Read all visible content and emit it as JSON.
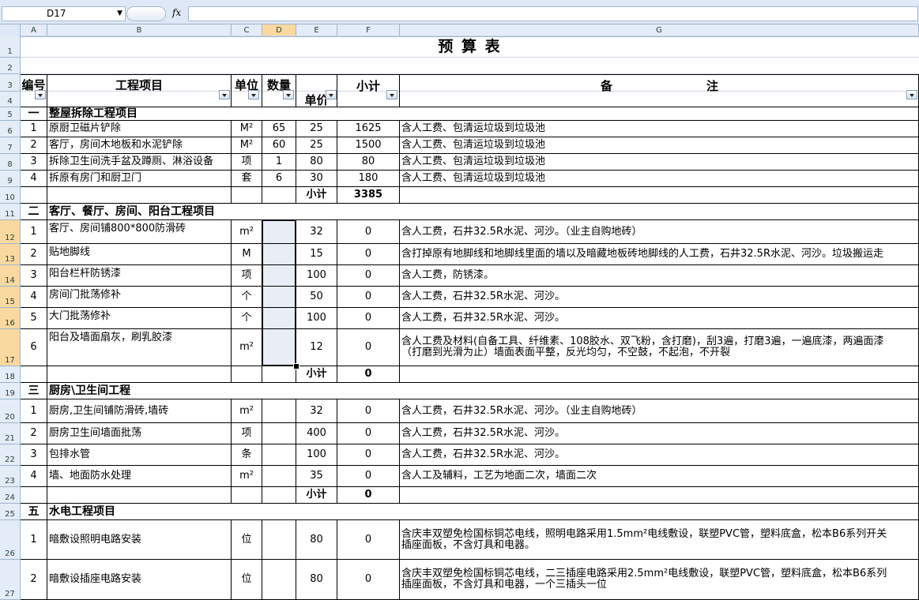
{
  "name_box": "D17",
  "fx_label": "fx",
  "formula_value": "",
  "columns": [
    "A",
    "B",
    "C",
    "D",
    "E",
    "F",
    "G"
  ],
  "rows": [
    "1",
    "2",
    "3",
    "4",
    "5",
    "6",
    "7",
    "8",
    "9",
    "10",
    "11",
    "12",
    "13",
    "14",
    "15",
    "16",
    "17",
    "18",
    "19",
    "20",
    "21",
    "22",
    "23",
    "24",
    "25",
    "26",
    "27"
  ],
  "title": "预 算 表",
  "header": {
    "no": "编号",
    "item": "工程项目",
    "unit": "单位",
    "qty": "数量",
    "price": "单价",
    "subtotal": "小计",
    "note_a": "备",
    "note_b": "注"
  },
  "sections": [
    {
      "no": "一",
      "title": "整屋拆除工程项目"
    },
    {
      "no": "二",
      "title": "客厅、餐厅、房间、阳台工程项目"
    },
    {
      "no": "三",
      "title": "厨房\\卫生间工程"
    },
    {
      "no": "五",
      "title": "水电工程项目"
    }
  ],
  "items1": [
    {
      "no": "1",
      "name": "原厨卫磁片铲除",
      "unit": "M²",
      "qty": "65",
      "price": "25",
      "sub": "1625",
      "note": "含人工费、包清运垃圾到垃圾池"
    },
    {
      "no": "2",
      "name": "客厅，房间木地板和水泥铲除",
      "unit": "M²",
      "qty": "60",
      "price": "25",
      "sub": "1500",
      "note": "含人工费、包清运垃圾到垃圾池"
    },
    {
      "no": "3",
      "name": "拆除卫生间洗手盆及蹲厕、淋浴设备",
      "unit": "项",
      "qty": "1",
      "price": "80",
      "sub": "80",
      "note": "含人工费、包清运垃圾到垃圾池"
    },
    {
      "no": "4",
      "name": "拆原有房门和厨卫门",
      "unit": "套",
      "qty": "6",
      "price": "30",
      "sub": "180",
      "note": "含人工费、包清运垃圾到垃圾池"
    }
  ],
  "items2": [
    {
      "no": "1",
      "name": "客厅、房间铺800*800防滑砖",
      "unit": "m²",
      "qty": "",
      "price": "32",
      "sub": "0",
      "note": "含人工费，石井32.5R水泥、河沙。（业主自购地砖）"
    },
    {
      "no": "2",
      "name": "贴地脚线",
      "unit": "M",
      "qty": "",
      "price": "15",
      "sub": "0",
      "note": "含打掉原有地脚线和地脚线里面的墙以及暗藏地板砖地脚线的人工费，石井32.5R水泥、河沙。垃圾搬运走"
    },
    {
      "no": "3",
      "name": "阳台栏杆防锈漆",
      "unit": "项",
      "qty": "",
      "price": "100",
      "sub": "0",
      "note": "含人工费，防锈漆。"
    },
    {
      "no": "4",
      "name": "房间门批荡修补",
      "unit": "个",
      "qty": "",
      "price": "50",
      "sub": "0",
      "note": "含人工费，石井32.5R水泥、河沙。"
    },
    {
      "no": "5",
      "name": "大门批荡修补",
      "unit": "个",
      "qty": "",
      "price": "100",
      "sub": "0",
      "note": "含人工费，石井32.5R水泥、河沙。"
    },
    {
      "no": "6",
      "name": "阳台及墙面扇灰，刷乳胶漆",
      "unit": "m²",
      "qty": "",
      "price": "12",
      "sub": "0",
      "note": "含人工费及材料(自备工具、纤维素、108胶水、双飞粉，含打磨)，刮3遍，打磨3遍，一遍底漆，两遍面漆",
      "note2": "（打磨到光滑为止）墙面表面平整，反光均匀，不空鼓，不起泡，不开裂"
    }
  ],
  "items3": [
    {
      "no": "1",
      "name": "厨房,卫生间铺防滑砖,墙砖",
      "unit": "m²",
      "qty": "",
      "price": "32",
      "sub": "0",
      "note": "含人工费，石井32.5R水泥、河沙。（业主自购地砖）"
    },
    {
      "no": "2",
      "name": "厨房卫生间墙面批荡",
      "unit": "项",
      "qty": "",
      "price": "400",
      "sub": "0",
      "note": "含人工费，石井32.5R水泥、河沙。"
    },
    {
      "no": "3",
      "name": "包排水管",
      "unit": "条",
      "qty": "",
      "price": "100",
      "sub": "0",
      "note": "含人工费，石井32.5R水泥、河沙。"
    },
    {
      "no": "4",
      "name": "墙、地面防水处理",
      "unit": "m²",
      "qty": "",
      "price": "35",
      "sub": "0",
      "note": "含人工及辅料，工艺为地面二次，墙面二次"
    }
  ],
  "items5": [
    {
      "no": "1",
      "name": "暗敷设照明电路安装",
      "unit": "位",
      "qty": "",
      "price": "80",
      "sub": "0",
      "note": "含庆丰双塑免检国标铜芯电线，照明电路采用1.5mm²电线敷设，联塑PVC管，塑料底盒，松本B6系列开关",
      "note2": "插座面板，不含灯具和电器。"
    },
    {
      "no": "2",
      "name": "暗敷设插座电路安装",
      "unit": "位",
      "qty": "",
      "price": "80",
      "sub": "0",
      "note": "含庆丰双塑免检国标铜芯电线，二三插座电路采用2.5mm²电线敷设，联塑PVC管，塑料底盒，松本B6系列",
      "note2": "插座面板，不含灯具和电器，一个三插头一位"
    }
  ],
  "subtotals": {
    "label": "小计",
    "s1": "3385",
    "s2": "0",
    "s3": "0"
  }
}
